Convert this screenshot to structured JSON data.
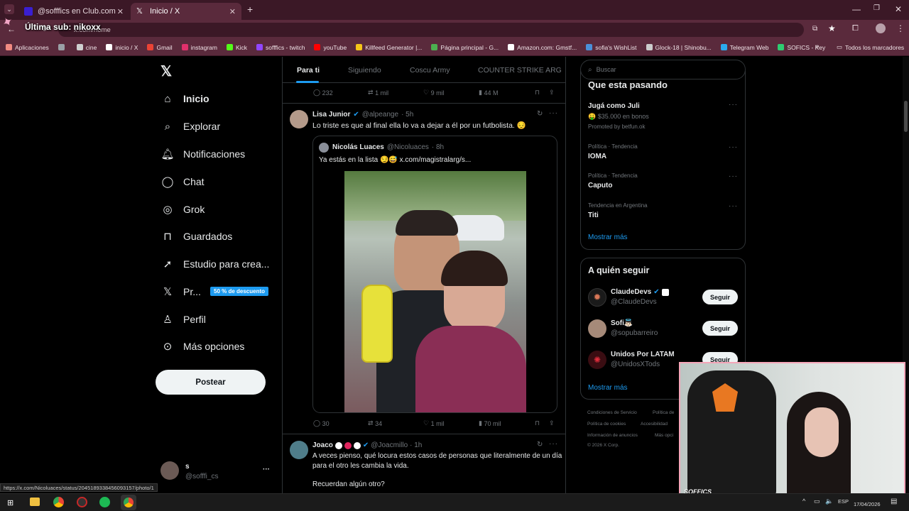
{
  "browser": {
    "tabs": [
      {
        "label": "@sofffics en Club.com"
      },
      {
        "label": "Inicio / X"
      }
    ],
    "new_tab_symbol": "+",
    "address": "x.com/home",
    "overlay_sub": "Última sub: nikoxx",
    "bookmarks": [
      {
        "label": "Aplicaciones",
        "color": "#f28b82"
      },
      {
        "label": "",
        "color": "#9aa0a6"
      },
      {
        "label": "cine",
        "color": "#cfcfcf"
      },
      {
        "label": "inicio / X",
        "color": "#ffffff"
      },
      {
        "label": "Gmail",
        "color": "#ea4335"
      },
      {
        "label": "instagram",
        "color": "#e1306c"
      },
      {
        "label": "Kick",
        "color": "#53fc18"
      },
      {
        "label": "sofffics - twitch",
        "color": "#9146ff"
      },
      {
        "label": "youTube",
        "color": "#ff0000"
      },
      {
        "label": "Killfeed Generator |...",
        "color": "#f5c518"
      },
      {
        "label": "Página principal - G...",
        "color": "#4caf50"
      },
      {
        "label": "Amazon.com: Gmstf...",
        "color": "#ffffff"
      },
      {
        "label": "sofia's WishList",
        "color": "#4a90d9"
      },
      {
        "label": "Glock-18 | Shinobu...",
        "color": "#cccccc"
      },
      {
        "label": "Telegram Web",
        "color": "#2aabee"
      },
      {
        "label": "SOFICS - Key",
        "color": "#2ecc71"
      }
    ],
    "bookmarks_more": "»",
    "all_bookmarks": "Todos los marcadores",
    "status_url": "https://x.com/Nicoluaces/status/2045189338456093157/photo/1"
  },
  "nav": {
    "items": [
      {
        "label": "Inicio",
        "icon": "home-icon"
      },
      {
        "label": "Explorar",
        "icon": "search-icon"
      },
      {
        "label": "Notificaciones",
        "icon": "bell-icon"
      },
      {
        "label": "Chat",
        "icon": "chat-icon"
      },
      {
        "label": "Grok",
        "icon": "grok-icon"
      },
      {
        "label": "Guardados",
        "icon": "bookmark-icon"
      },
      {
        "label": "Estudio para crea...",
        "icon": "rocket-icon"
      },
      {
        "label": "Pr...",
        "icon": "x-premium-icon"
      },
      {
        "label": "Perfil",
        "icon": "person-icon"
      },
      {
        "label": "Más opciones",
        "icon": "more-circle-icon"
      }
    ],
    "premium_badge": "50 % de descuento",
    "post_button": "Postear",
    "account": {
      "name": "s",
      "handle": "@sofffi_cs",
      "more": "···"
    }
  },
  "timeline": {
    "tabs": [
      "Para ti",
      "Siguiendo",
      "Coscu Army",
      "COUNTER STRIKE ARG"
    ],
    "prev_metrics": {
      "replies": "232",
      "reposts": "1 mil",
      "likes": "9 mil",
      "views": "44 M"
    },
    "tweet1": {
      "name": "Lisa Junior",
      "handle": "@alpeange",
      "time": "· 5h",
      "text": "Lo triste es que al final ella lo va a dejar a él por un futbolista. 😔",
      "quote": {
        "name": "Nicolás Luaces",
        "handle": "@Nicoluaces",
        "time": "· 8h",
        "text": "Ya estás en la lista 😏😅  x.com/magistralarg/s..."
      },
      "metrics": {
        "replies": "30",
        "reposts": "34",
        "likes": "1 mil",
        "views": "70 mil"
      }
    },
    "tweet2": {
      "name": "Joaco",
      "handle": "@Joacmillo",
      "time": "· 1h",
      "text_line1": "A veces pienso, qué locura estos casos de personas que literalmente de un día",
      "text_line2": "para el otro les cambia la vida.",
      "text_line3": "Recuerdan algún otro?"
    }
  },
  "sidebar": {
    "search_placeholder": "Buscar",
    "trends_title": "Que esta pasando",
    "trends": [
      {
        "title": "Jugá como Juli",
        "sub": "🤑 $35.000 en bonos",
        "promo": "Promoted by betfun.ok"
      },
      {
        "context": "Política · Tendencia",
        "title": "IOMA"
      },
      {
        "context": "Política · Tendencia",
        "title": "Caputo"
      },
      {
        "context": "Tendencia en Argentina",
        "title": "Titi"
      }
    ],
    "show_more": "Mostrar más",
    "follow_title": "A quién seguir",
    "follow": [
      {
        "name": "ClaudeDevs",
        "handle": "@ClaudeDevs",
        "button": "Seguir"
      },
      {
        "name": "Sofi👼🏻",
        "handle": "@sopubarreiro",
        "button": "Seguir"
      },
      {
        "name": "Unidos Por LATAM",
        "handle": "@UnidosXTods",
        "button": "Seguir"
      }
    ],
    "follow_show_more": "Mostrar más",
    "footer": [
      "Condiciones de Servicio",
      "Política de",
      "Política de cookies",
      "Accesibilidad",
      "Información de anuncios",
      "Más opci",
      "© 2026 X Corp."
    ]
  },
  "webcam": {
    "label": "SOFFICS"
  },
  "taskbar": {
    "lang": "ESP",
    "date": "17/04/2026"
  },
  "colors": {
    "accent": "#1d9bf0",
    "chrome": "#5a2a3c",
    "tabbar": "#3b1826"
  }
}
